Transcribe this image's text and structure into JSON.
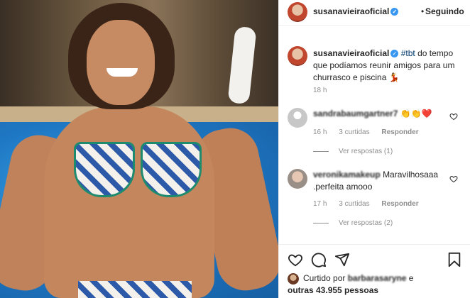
{
  "header": {
    "username": "susanavieiraoficial",
    "dot": "•",
    "follow_label": "Seguindo"
  },
  "caption": {
    "username": "susanavieiraoficial",
    "hashtag": "#tbt",
    "text": " do tempo que podíamos reunir amigos para um churrasco e piscina 💃",
    "time": "18 h"
  },
  "comments": [
    {
      "username": "sandrabaumgartner7",
      "text": "👏👏❤️",
      "time": "16 h",
      "likes": "3 curtidas",
      "reply_label": "Responder",
      "view_replies": "Ver respostas (1)"
    },
    {
      "username": "veronikamakeup",
      "text": "Maravilhosaaa .perfeita amooo",
      "time": "17 h",
      "likes": "3 curtidas",
      "reply_label": "Responder",
      "view_replies": "Ver respostas (2)"
    }
  ],
  "likes": {
    "prefix": "Curtido por",
    "liker": "barbarasaryne",
    "conjunction": "e",
    "others": "outras 43.955 pessoas"
  },
  "icons": {
    "verified": "verified-badge-icon",
    "like": "heart-icon",
    "comment": "comment-icon",
    "share": "share-icon",
    "save": "bookmark-icon"
  },
  "colors": {
    "verified": "#3897f0",
    "hashtag": "#00376b",
    "muted": "#8e8e8e"
  }
}
